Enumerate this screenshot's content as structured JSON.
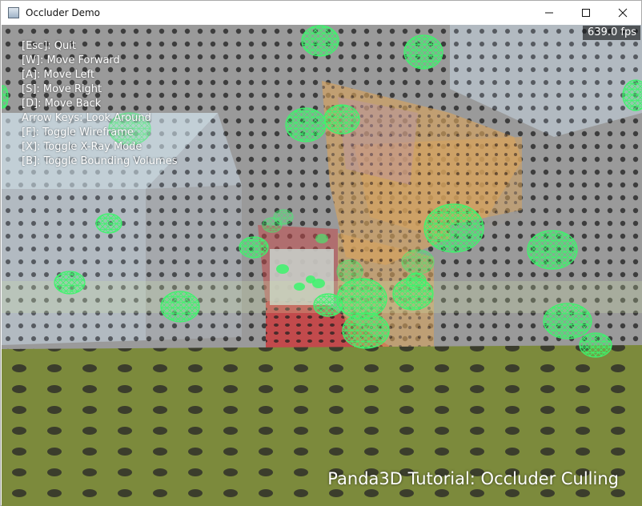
{
  "window": {
    "title": "Occluder Demo",
    "icon": "app-window-icon",
    "controls": [
      "minimize-icon",
      "maximize-icon",
      "close-icon"
    ]
  },
  "hud": {
    "fps": "639.0 fps",
    "instructions": [
      "[Esc]: Quit",
      "[W]: Move Forward",
      "[A]: Move Left",
      "[S]: Move Right",
      "[D]: Move Back",
      "Arrow Keys: Look Around",
      "[F]: Toggle Wireframe",
      "[X]: Toggle X-Ray Mode",
      "[B]: Toggle Bounding Volumes"
    ],
    "tutorial_title": "Panda3D Tutorial: Occluder Culling"
  },
  "colors": {
    "floor": "#7c8a3c",
    "wall": "#8f8f8f",
    "bounding_sphere": "#3cf56c",
    "red_path": "#c84a4a",
    "orange_block": "#d9a15a"
  }
}
